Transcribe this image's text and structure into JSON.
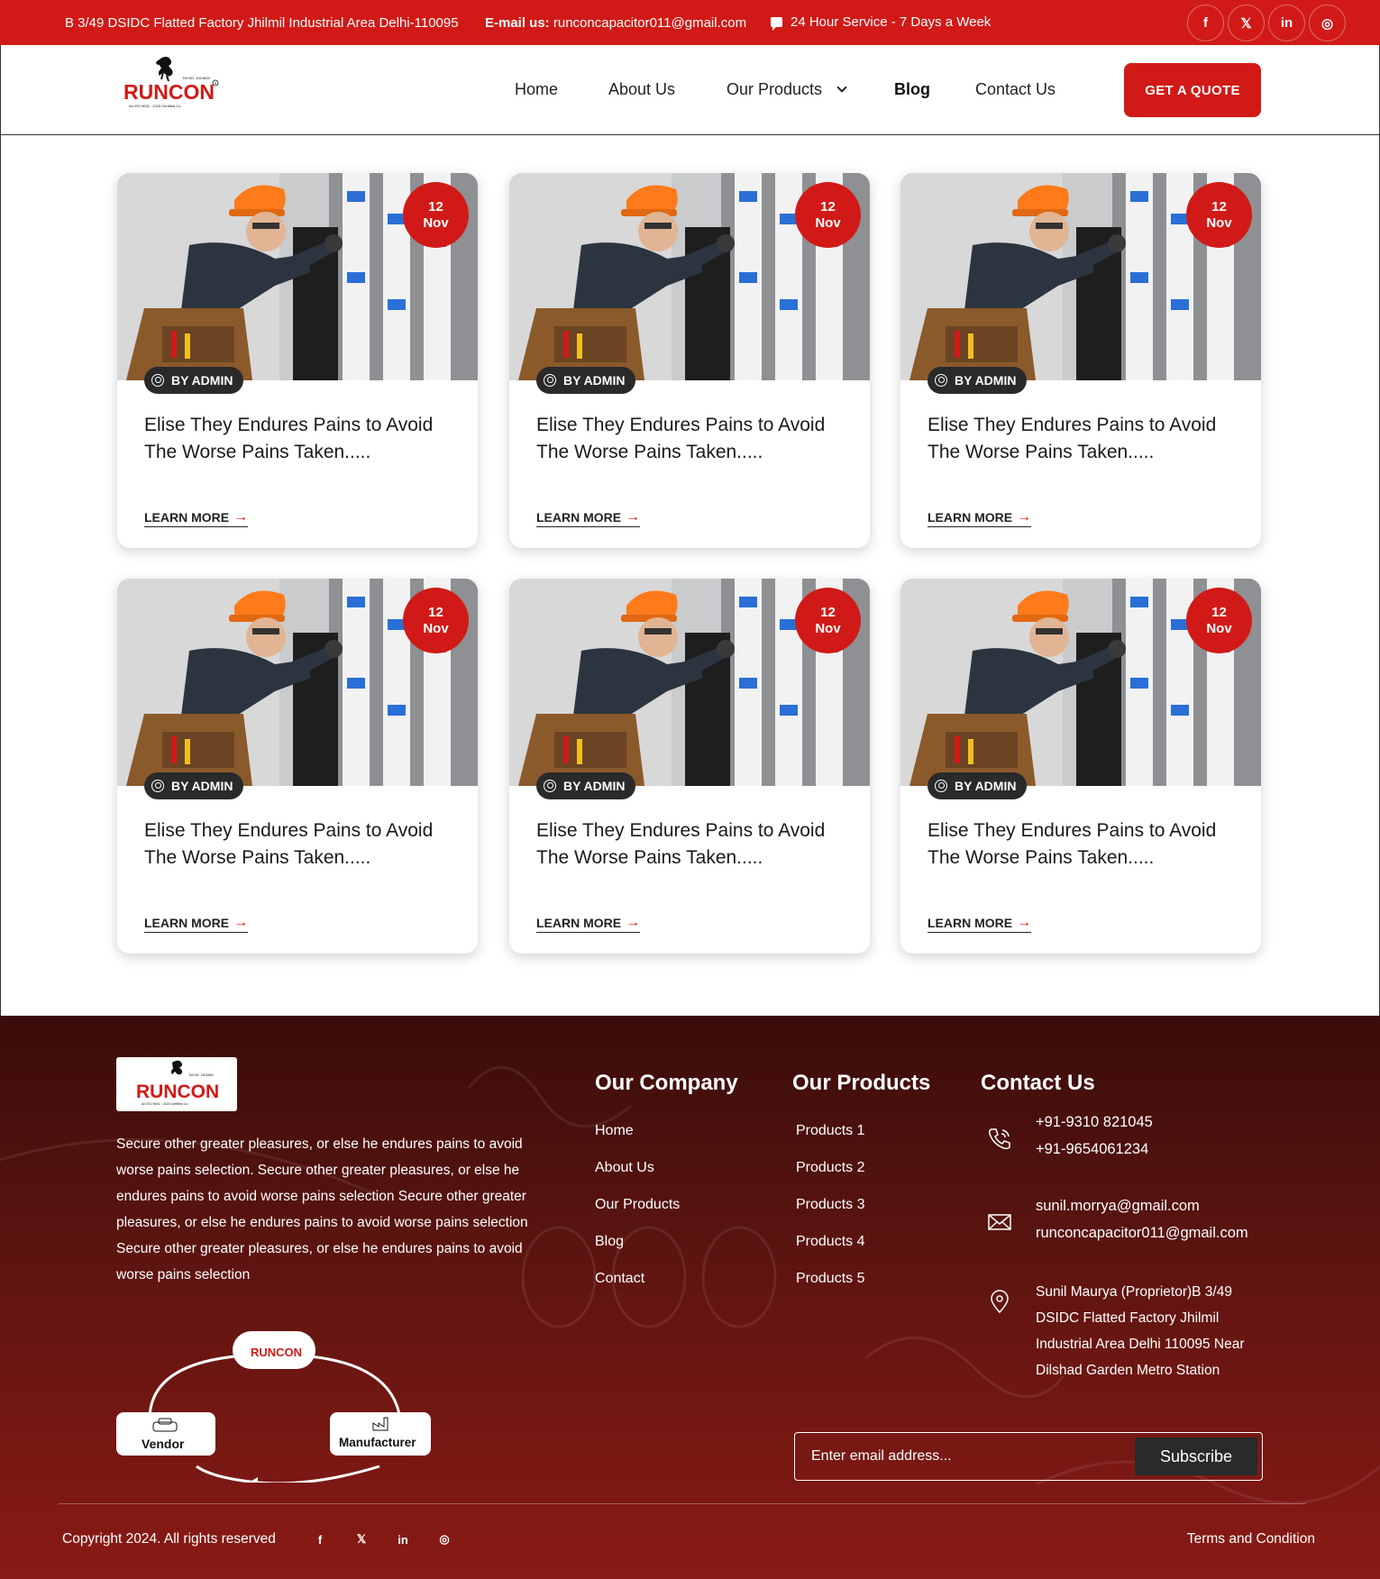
{
  "topbar": {
    "address": "B 3/49 DSIDC Flatted Factory Jhilmil Industrial Area Delhi-110095",
    "email_label": "E-mail us:",
    "email": "runconcapacitor011@gmail.com",
    "service": "24 Hour Service - 7 Days a Week",
    "socials": [
      {
        "name": "facebook",
        "glyph": "f"
      },
      {
        "name": "x",
        "glyph": "𝕏"
      },
      {
        "name": "linkedin",
        "glyph": "in"
      },
      {
        "name": "instagram",
        "glyph": "◎"
      }
    ]
  },
  "brand": {
    "name": "RUNCON",
    "tm": "TM NO. 1524653",
    "iso": "An ISO 9001 : 2015 Certified Co.",
    "accent": "#d11a17"
  },
  "nav": {
    "items": [
      "Home",
      "About Us",
      "Our Products",
      "Blog",
      "Contact Us"
    ],
    "active": "Blog",
    "cta": "GET A QUOTE"
  },
  "posts": [
    {
      "day": "12",
      "month": "Nov",
      "author": "BY ADMIN",
      "title": "Elise They Endures Pains to Avoid The Worse Pains Taken.....",
      "cta": "LEARN MORE"
    },
    {
      "day": "12",
      "month": "Nov",
      "author": "BY ADMIN",
      "title": "Elise They Endures Pains to Avoid The Worse Pains Taken.....",
      "cta": "LEARN MORE"
    },
    {
      "day": "12",
      "month": "Nov",
      "author": "BY ADMIN",
      "title": "Elise They Endures Pains to Avoid The Worse Pains Taken.....",
      "cta": "LEARN MORE"
    },
    {
      "day": "12",
      "month": "Nov",
      "author": "BY ADMIN",
      "title": "Elise They Endures Pains to Avoid The Worse Pains Taken.....",
      "cta": "LEARN MORE"
    },
    {
      "day": "12",
      "month": "Nov",
      "author": "BY ADMIN",
      "title": "Elise They Endures Pains to Avoid The Worse Pains Taken.....",
      "cta": "LEARN MORE"
    },
    {
      "day": "12",
      "month": "Nov",
      "author": "BY ADMIN",
      "title": "Elise They Endures Pains to Avoid The Worse Pains Taken.....",
      "cta": "LEARN MORE"
    }
  ],
  "footer": {
    "about": "Secure other greater pleasures, or else he endures pains to avoid worse pains selection. Secure other greater pleasures, or else he endures pains to avoid worse pains selection Secure other greater pleasures, or else he endures pains to avoid worse pains selection Secure other greater pleasures, or else he endures pains to avoid worse pains selection",
    "cycle": {
      "vendor": "Vendor",
      "manufacturer": "Manufacturer"
    },
    "company": {
      "heading": "Our Company",
      "links": [
        "Home",
        "About Us",
        "Our Products",
        "Blog",
        "Contact"
      ]
    },
    "products": {
      "heading": "Our Products",
      "links": [
        "Products 1",
        "Products 2",
        "Products 3",
        "Products 4",
        "Products 5"
      ]
    },
    "contact": {
      "heading": "Contact Us",
      "phone1": "+91-9310 821045",
      "phone2": "+91-9654061234",
      "email1": "sunil.morrya@gmail.com",
      "email2": "runconcapacitor011@gmail.com",
      "address": "Sunil Maurya (Proprietor)B 3/49 DSIDC Flatted Factory Jhilmil Industrial Area Delhi 110095 Near Dilshad Garden Metro Station"
    },
    "subscribe": {
      "placeholder": "Enter email address...",
      "button": "Subscribe"
    },
    "copyright": "Copyright 2024. All rights reserved",
    "terms": "Terms and Condition"
  }
}
